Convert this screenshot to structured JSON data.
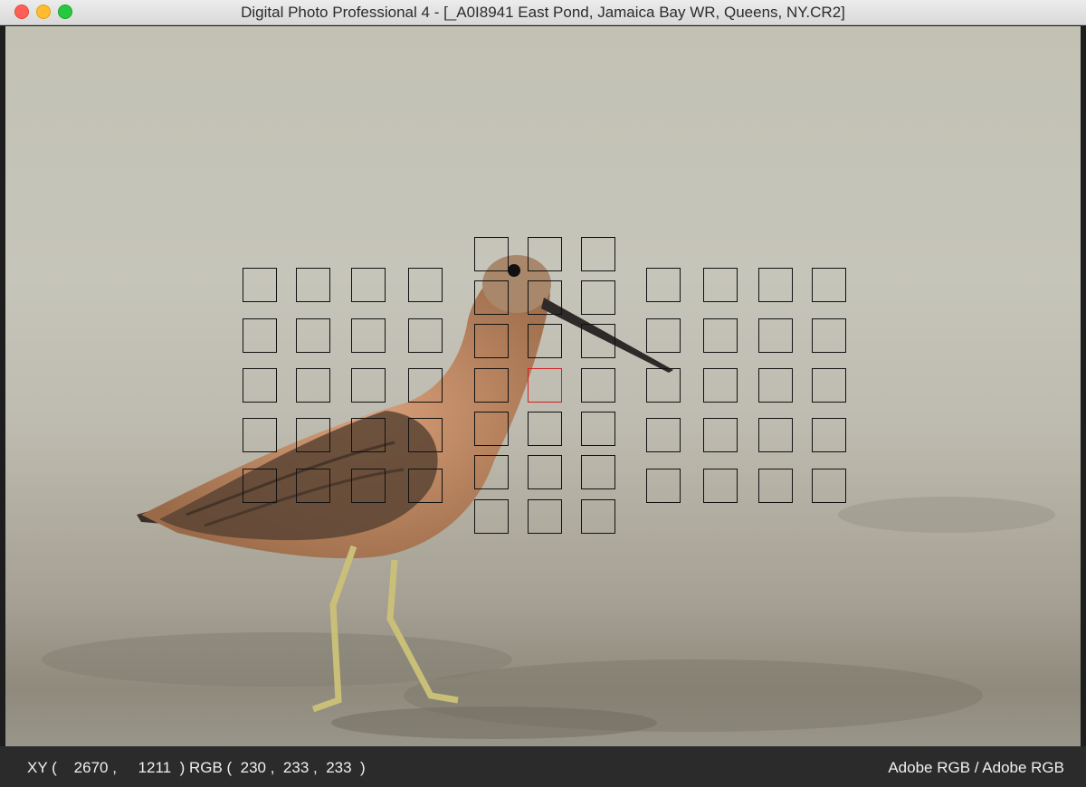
{
  "window": {
    "title": "Digital Photo Professional 4 - [_A0I8941 East Pond, Jamaica Bay WR, Queens, NY.CR2]"
  },
  "status": {
    "xy_label": "XY (",
    "x": "2670",
    "y": "1211",
    "rgb_label": ") RGB (",
    "r": "230",
    "g": "233",
    "b": "233",
    "close_paren": ")",
    "color_space": "Adobe RGB / Adobe RGB"
  },
  "af_points": {
    "active": "row 3, column 6 (center group)"
  },
  "colors": {
    "af_inactive": "#111111",
    "af_active": "#d42020",
    "status_bg": "#2b2b2b"
  }
}
